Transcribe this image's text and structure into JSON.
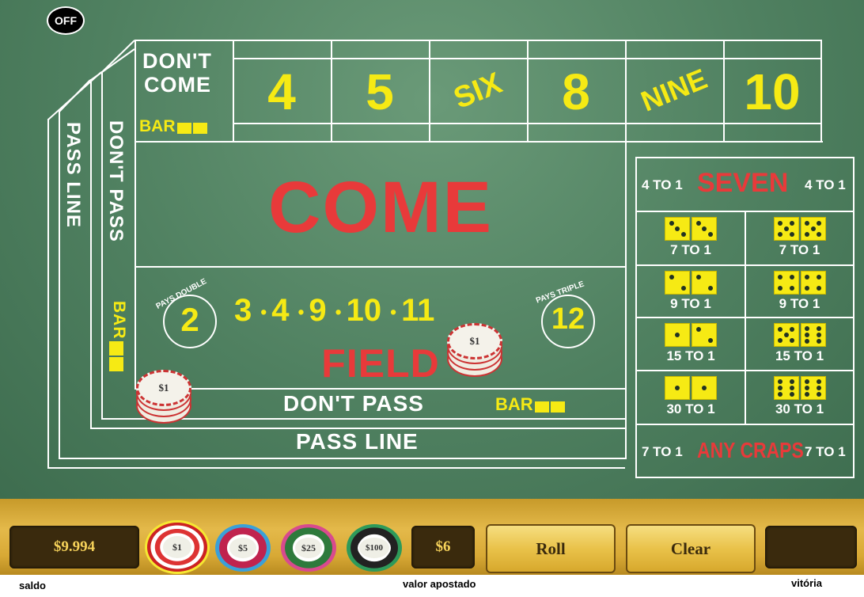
{
  "sound_toggle": {
    "label": "OFF"
  },
  "table": {
    "dont_come": {
      "line1": "DON'T",
      "line2": "COME",
      "bar": "BAR"
    },
    "place_numbers": [
      "4",
      "5",
      "SIX",
      "8",
      "NINE",
      "10"
    ],
    "come": "COME",
    "field": {
      "label": "FIELD",
      "pays_double": "PAYS DOUBLE",
      "pays_triple": "PAYS TRIPLE",
      "double_num": "2",
      "triple_num": "12",
      "numbers": [
        "3",
        "4",
        "9",
        "10",
        "11"
      ]
    },
    "dont_pass_bar": {
      "label": "DON'T PASS",
      "bar": "BAR"
    },
    "pass_line": "PASS LINE",
    "vertical_pass_line": "PASS LINE",
    "vertical_dont_pass": "DON'T PASS",
    "vertical_bar": "BAR"
  },
  "proposition": {
    "seven": {
      "label": "SEVEN",
      "left_odds": "4 TO 1",
      "right_odds": "4 TO 1"
    },
    "hardways": [
      {
        "odds": "7 TO 1",
        "dice": [
          3,
          3
        ]
      },
      {
        "odds": "7 TO 1",
        "dice": [
          5,
          5
        ]
      },
      {
        "odds": "9 TO 1",
        "dice": [
          2,
          2
        ]
      },
      {
        "odds": "9 TO 1",
        "dice": [
          4,
          4
        ]
      },
      {
        "odds": "15 TO 1",
        "dice": [
          1,
          2
        ]
      },
      {
        "odds": "15 TO 1",
        "dice": [
          5,
          6
        ]
      },
      {
        "odds": "30 TO 1",
        "dice": [
          1,
          1
        ]
      },
      {
        "odds": "30 TO 1",
        "dice": [
          6,
          6
        ]
      }
    ],
    "any_craps": {
      "label": "ANY CRAPS",
      "left_odds": "7 TO 1",
      "right_odds": "7 TO 1"
    }
  },
  "placed_chips": [
    {
      "label": "$1",
      "location": "field"
    },
    {
      "label": "$1",
      "location": "pass-line"
    }
  ],
  "controls": {
    "balance": "$9.994",
    "chips": [
      {
        "label": "$1",
        "selected": true
      },
      {
        "label": "$5",
        "selected": false
      },
      {
        "label": "$25",
        "selected": false
      },
      {
        "label": "$100",
        "selected": false
      }
    ],
    "bet_amount": "$6",
    "roll_label": "Roll",
    "clear_label": "Clear",
    "win_amount": ""
  },
  "footer": {
    "balance_label": "saldo",
    "bet_label": "valor apostado",
    "win_label": "vitória"
  }
}
